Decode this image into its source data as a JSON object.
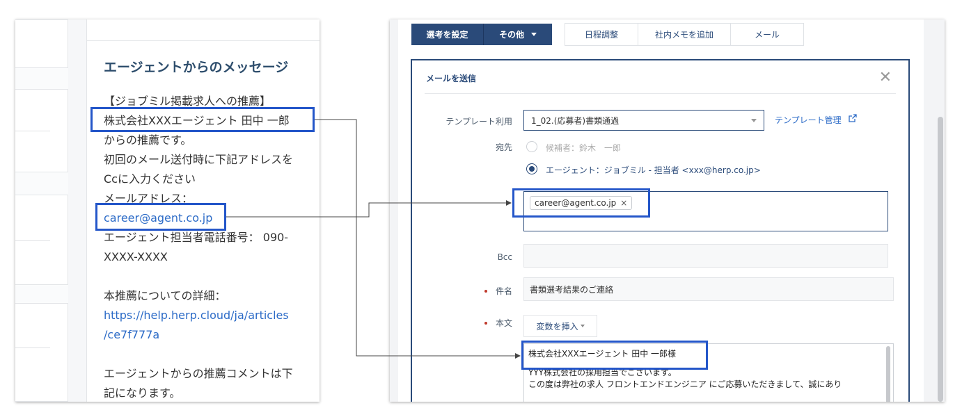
{
  "left": {
    "title": "エージェントからのメッセージ",
    "lines": [
      "【ジョブミル掲載求人への推薦】",
      "株式会社XXXエージェント 田中 一郎",
      "からの推薦です。",
      "初回のメール送付時に下記アドレスを",
      "Ccに入力ください",
      "メールアドレス：",
      "career@agent.co.jp",
      "エージェント担当者電話番号： 090-",
      "XXXX-XXXX",
      "",
      "本推薦についての詳細：",
      "https://help.herp.cloud/ja/articles",
      "/ce7f777a",
      "",
      "エージェントからの推薦コメントは下",
      "記になります。"
    ]
  },
  "toolbar": {
    "set_selection": "選考を設定",
    "other": "その他",
    "schedule": "日程調整",
    "add_memo": "社内メモを追加",
    "mail": "メール"
  },
  "modal": {
    "title": "メールを送信",
    "template_label": "テンプレート利用",
    "template_value": "1_02.(応募者)書類通過",
    "template_manage": "テンプレート管理",
    "to_label": "宛先",
    "to_candidate": "候補者：鈴木　一郎",
    "to_agent": "エージェント：ジョブミル - 担当者 <xxx@herp.co.jp>",
    "cc_chip": "career@agent.co.jp",
    "cc_chip_remove": "×",
    "bcc_label": "Bcc",
    "subject_label": "件名",
    "subject_value": "書類選考結果のご連絡",
    "body_label": "本文",
    "insert_var": "変数を挿入",
    "body_lines": [
      "株式会社XXXエージェント 田中 一郎様",
      "",
      "YYY株式会社の採用担当でございます。",
      "この度は弊社の求人 フロントエンドエンジニア にご応募いただきまして、誠にあり"
    ]
  },
  "colors": {
    "highlight": "#2456c9",
    "primary": "#2a4a79",
    "link": "#2c6bc7"
  }
}
